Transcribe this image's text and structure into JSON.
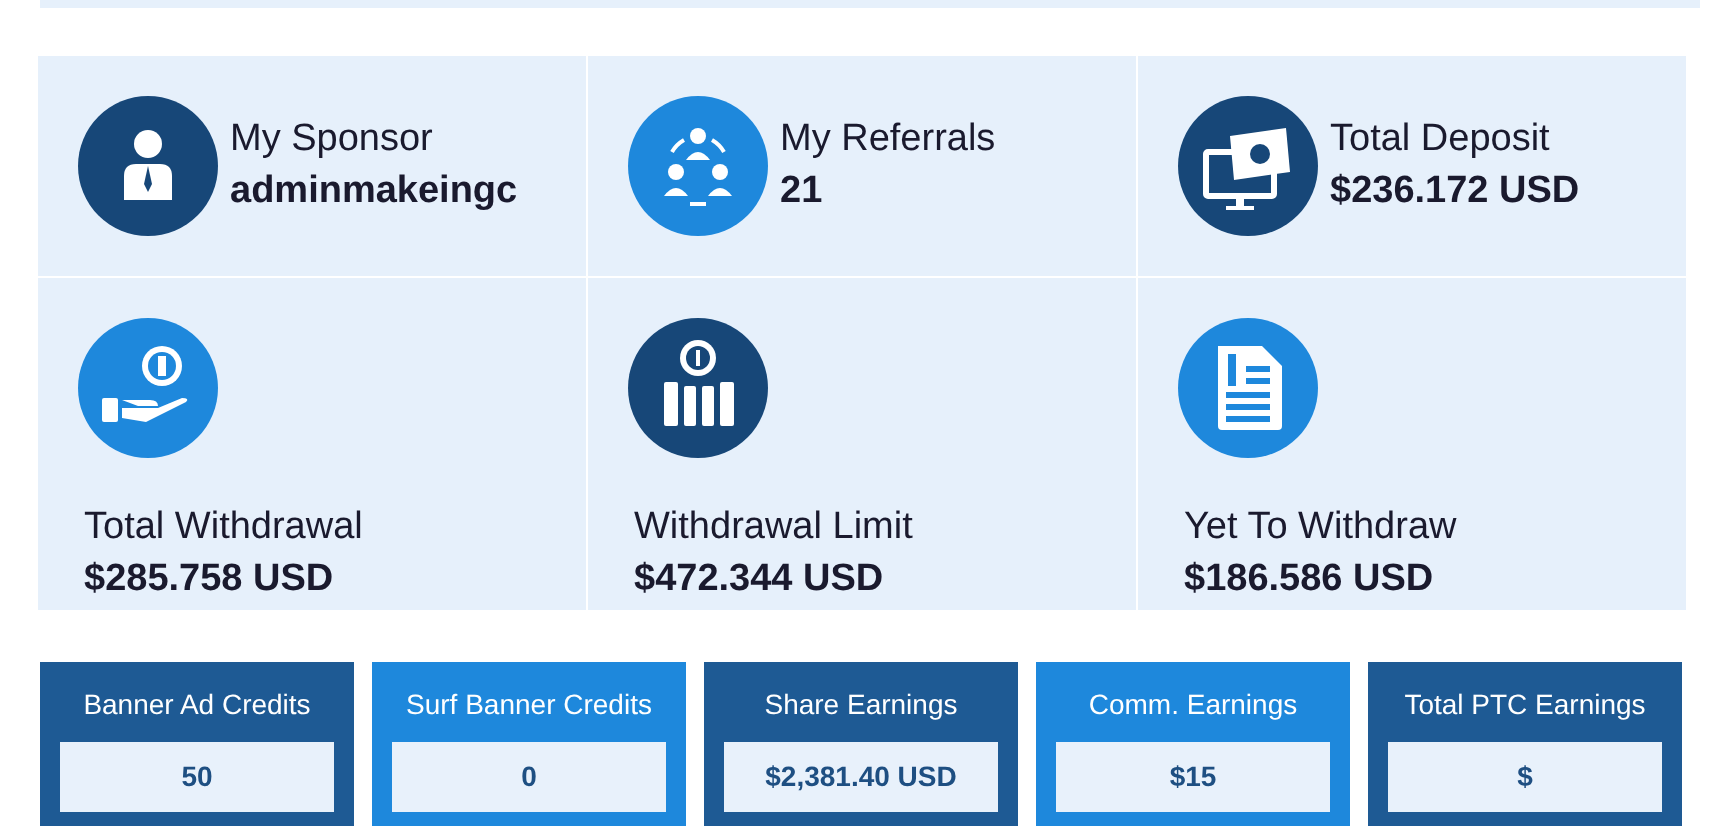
{
  "stats": [
    {
      "kind": "inline",
      "color": "#174778",
      "label": "My Sponsor",
      "value": "adminmakeingc"
    },
    {
      "kind": "inline",
      "color": "#1e88dc",
      "label": "My Referrals",
      "value": "21"
    },
    {
      "kind": "inline",
      "color": "#174778",
      "label": "Total Deposit",
      "value": "$236.172 USD"
    },
    {
      "kind": "stacked",
      "color": "#1e88dc",
      "label": "Total Withdrawal",
      "value": "$285.758 USD"
    },
    {
      "kind": "stacked",
      "color": "#174778",
      "label": "Withdrawal Limit",
      "value": "$472.344 USD"
    },
    {
      "kind": "stacked",
      "color": "#1e88dc",
      "label": "Yet To Withdraw",
      "value": "$186.586 USD"
    }
  ],
  "tiles": [
    {
      "color": "#1e5a94",
      "label": "Banner Ad Credits",
      "value": "50"
    },
    {
      "color": "#1e88dc",
      "label": "Surf Banner Credits",
      "value": "0"
    },
    {
      "color": "#1e5a94",
      "label": "Share Earnings",
      "value": "$2,381.40 USD"
    },
    {
      "color": "#1e88dc",
      "label": "Comm. Earnings",
      "value": "$15"
    },
    {
      "color": "#1e5a94",
      "label": "Total PTC Earnings",
      "value": "$"
    }
  ]
}
